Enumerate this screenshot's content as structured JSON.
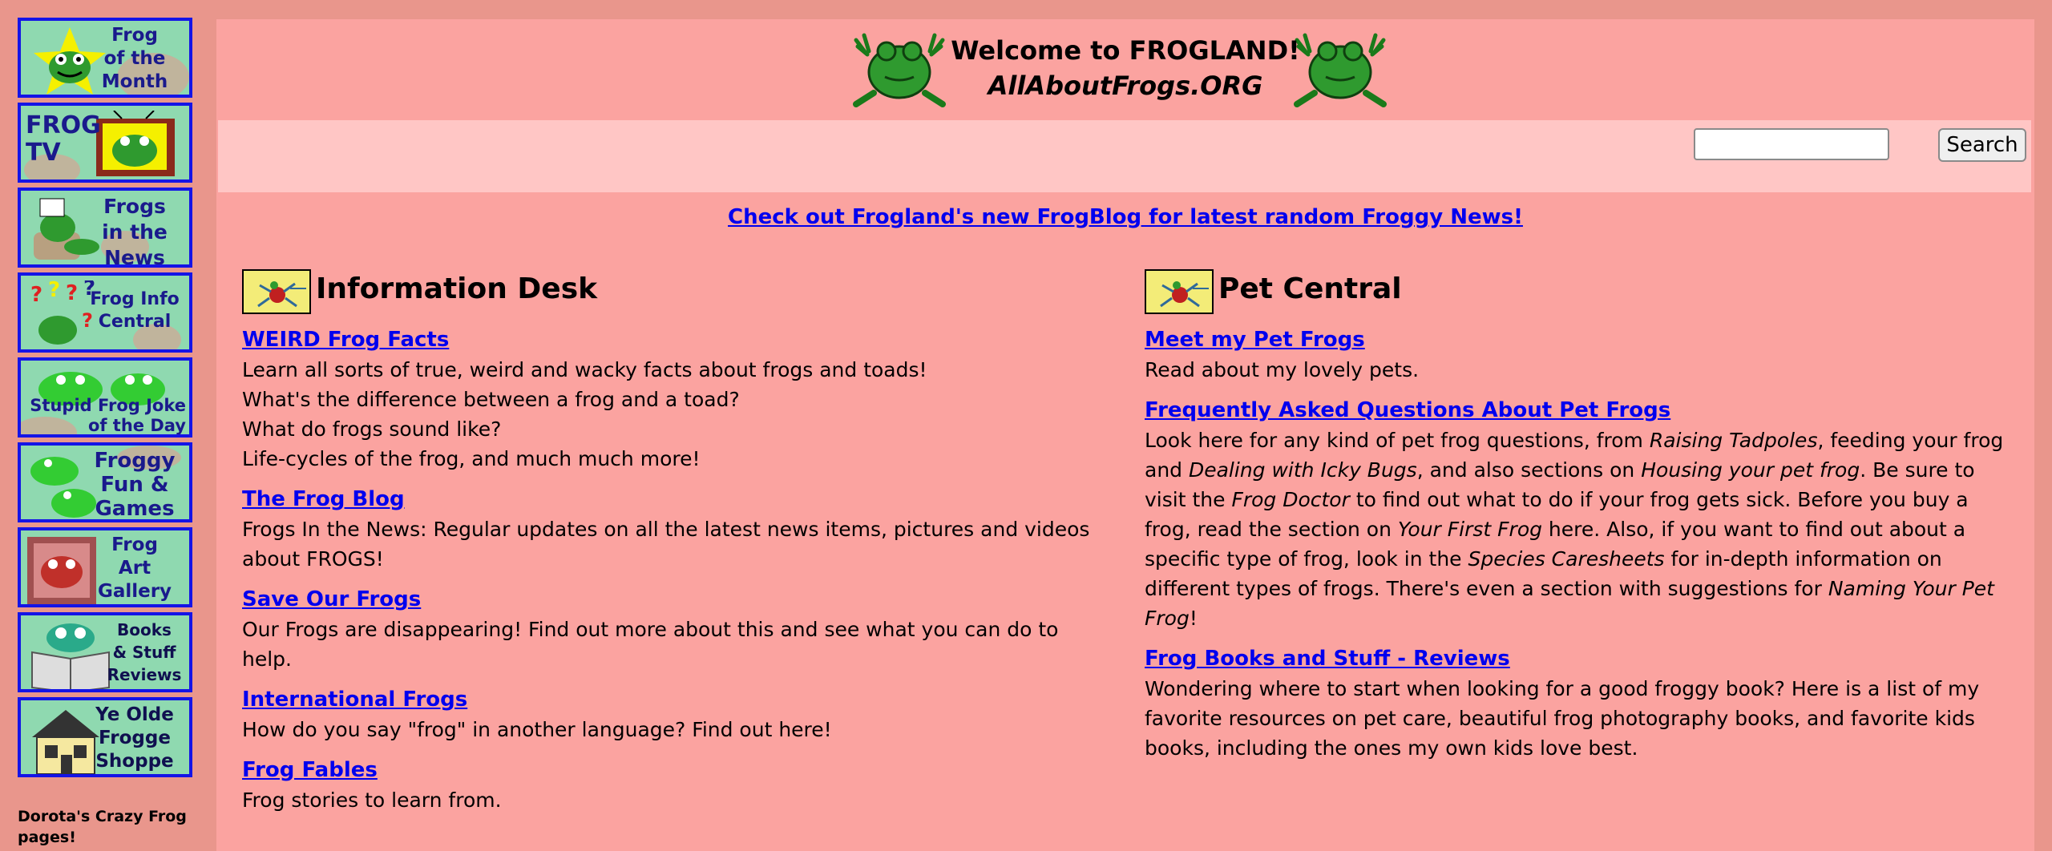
{
  "sidebar": {
    "items": [
      {
        "label": "Frog\nof the\nMonth"
      },
      {
        "label": "FROG TV"
      },
      {
        "label": "Frogs\nin the\nNews"
      },
      {
        "label": "Frog Info\nCentral"
      },
      {
        "label": "Stupid Frog Joke\nof the Day"
      },
      {
        "label": "Froggy\nFun &\nGames"
      },
      {
        "label": "Frog\nArt\nGallery"
      },
      {
        "label": "Books\n& Stuff\nReviews"
      },
      {
        "label": "Ye Olde\nFrogge\nShoppe"
      }
    ],
    "credit": "Dorota's Crazy Frog pages!"
  },
  "header": {
    "title": "Welcome to FROGLAND!",
    "subtitle": "AllAboutFrogs.ORG"
  },
  "search": {
    "value": "",
    "button_label": "Search"
  },
  "blog_link": "Check out Frogland's new FrogBlog for latest random Froggy News!",
  "info_desk": {
    "title": "Information Desk",
    "entries": [
      {
        "link": "WEIRD Frog Facts",
        "lines": [
          "Learn all sorts of true, weird and wacky facts about frogs and toads!",
          "What's the difference between a frog and a toad?",
          "What do frogs sound like?",
          "Life-cycles of the frog, and much much more!"
        ]
      },
      {
        "link": "The Frog Blog",
        "lines": [
          "Frogs In the News: Regular updates on all the latest news items, pictures and videos about FROGS!"
        ]
      },
      {
        "link": "Save Our Frogs",
        "lines": [
          "Our Frogs are disappearing! Find out more about this and see what you can do to help."
        ]
      },
      {
        "link": "International Frogs",
        "lines": [
          "How do you say \"frog\" in another language? Find out here!"
        ]
      },
      {
        "link": "Frog Fables",
        "lines": [
          "Frog stories to learn from."
        ]
      }
    ]
  },
  "pet_central": {
    "title": "Pet Central",
    "entries": [
      {
        "link": "Meet my Pet Frogs",
        "text": "Read about my lovely pets."
      },
      {
        "link": "Frequently Asked Questions About Pet Frogs",
        "parts": [
          {
            "t": "Look here for any kind of pet frog questions, from ",
            "i": false
          },
          {
            "t": "Raising Tadpoles",
            "i": true
          },
          {
            "t": ", feeding your frog and ",
            "i": false
          },
          {
            "t": "Dealing with Icky Bugs",
            "i": true
          },
          {
            "t": ", and also sections on ",
            "i": false
          },
          {
            "t": "Housing your pet frog",
            "i": true
          },
          {
            "t": ". Be sure to visit the ",
            "i": false
          },
          {
            "t": "Frog Doctor",
            "i": true
          },
          {
            "t": " to find out what to do if your frog gets sick. Before you buy a frog, read the section on ",
            "i": false
          },
          {
            "t": "Your First Frog",
            "i": true
          },
          {
            "t": " here. Also, if you want to find out about a specific type of frog, look in the ",
            "i": false
          },
          {
            "t": "Species Caresheets",
            "i": true
          },
          {
            "t": " for in-depth information on different types of frogs. There's even a section with suggestions for ",
            "i": false
          },
          {
            "t": "Naming Your Pet Frog",
            "i": true
          },
          {
            "t": "!",
            "i": false
          }
        ]
      },
      {
        "link": "Frog Books and Stuff - Reviews",
        "text": "Wondering where to start when looking for a good froggy book? Here is a list of my favorite resources on pet care, beautiful frog photography books, and favorite kids books, including the ones my own kids love best."
      }
    ]
  },
  "colors": {
    "page_bg": "#e9968c",
    "content_bg": "#fba3a0",
    "search_bar_bg": "#ffc6c5",
    "link": "#0000ee",
    "nav_border": "#1414e6",
    "frog_green": "#2f9a2f"
  },
  "icons": [
    "frog-icon",
    "running-bug-icon"
  ]
}
